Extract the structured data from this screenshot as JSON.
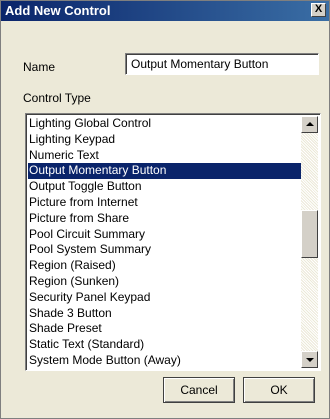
{
  "dialog": {
    "title": "Add New Control",
    "close_label": "X"
  },
  "form": {
    "name_label": "Name",
    "name_value": "Output Momentary Button",
    "control_type_label": "Control Type"
  },
  "list": {
    "items": [
      {
        "label": "Lighting Global Control",
        "selected": false
      },
      {
        "label": "Lighting Keypad",
        "selected": false
      },
      {
        "label": "Numeric Text",
        "selected": false
      },
      {
        "label": "Output Momentary Button",
        "selected": true
      },
      {
        "label": "Output Toggle Button",
        "selected": false
      },
      {
        "label": "Picture from Internet",
        "selected": false
      },
      {
        "label": "Picture from Share",
        "selected": false
      },
      {
        "label": "Pool Circuit Summary",
        "selected": false
      },
      {
        "label": "Pool System Summary",
        "selected": false
      },
      {
        "label": "Region (Raised)",
        "selected": false
      },
      {
        "label": "Region (Sunken)",
        "selected": false
      },
      {
        "label": "Security Panel Keypad",
        "selected": false
      },
      {
        "label": "Shade 3 Button",
        "selected": false
      },
      {
        "label": "Shade Preset",
        "selected": false
      },
      {
        "label": "Static Text (Standard)",
        "selected": false
      },
      {
        "label": "System Mode Button (Away)",
        "selected": false
      }
    ]
  },
  "buttons": {
    "cancel_label": "Cancel",
    "ok_label": "OK"
  },
  "colors": {
    "title_bar": "#0a246a",
    "selection": "#0a246a",
    "dialog_bg": "#ece9d8"
  }
}
